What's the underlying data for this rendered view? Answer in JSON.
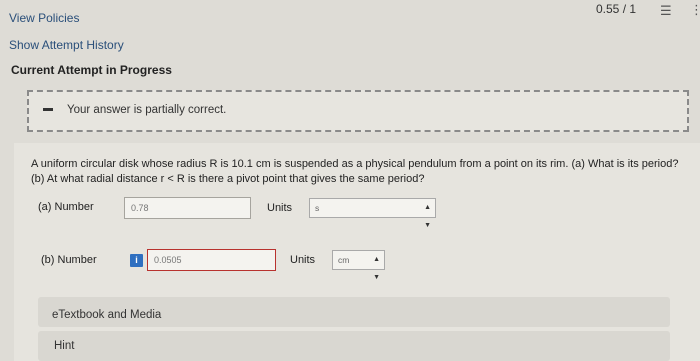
{
  "header": {
    "score": "0.55 / 1",
    "list_icon": "list-icon",
    "more_icon": "more-vertical-icon"
  },
  "links": {
    "view_policies": "View Policies",
    "show_history": "Show Attempt History"
  },
  "current_attempt": "Current Attempt in Progress",
  "feedback": {
    "message": "Your answer is partially correct.",
    "icon": "minus-icon"
  },
  "question": "A uniform circular disk whose radius R is 10.1 cm is suspended as a physical pendulum from a point on its rim. (a) What is its period? (b) At what radial distance r < R is there a pivot point that gives the same period?",
  "parts": [
    {
      "label": "(a)  Number",
      "value": "0.78",
      "units_label": "Units",
      "unit": "s",
      "status": "correct"
    },
    {
      "label": "(b)  Number",
      "value": "0.0505",
      "units_label": "Units",
      "unit": "cm",
      "status": "incorrect"
    }
  ],
  "panels": {
    "etextbook": "eTextbook and Media",
    "hint": "Hint"
  },
  "colors": {
    "correct_border": "#a6a49e",
    "incorrect_border": "#b8322e",
    "info_button": "#2f6fc0"
  }
}
